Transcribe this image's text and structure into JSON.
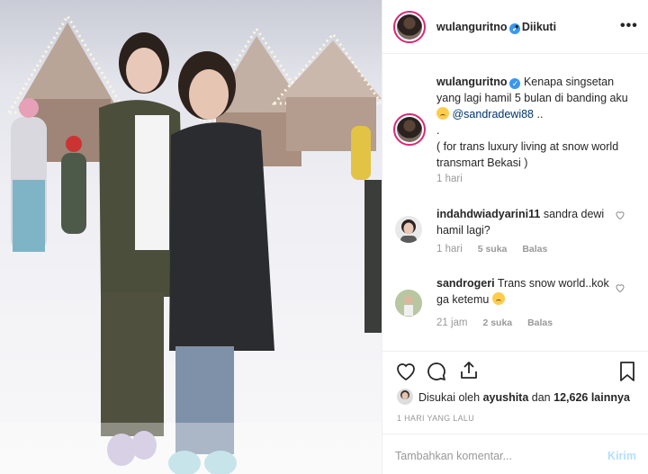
{
  "post": {
    "username": "wulanguritno",
    "follow_status": "Diikuti",
    "more_label": "•••",
    "caption_text": "Kenapa singsetan yang lagi hamil 5 bulan di banding aku",
    "caption_mention": "@sandradewi88",
    "caption_after": "..",
    "caption_dot": ".",
    "caption_extra": "( for trans luxury living at snow world transmart Bekasi )",
    "caption_time": "1 hari"
  },
  "comments": [
    {
      "username": "indahdwiadyarini11",
      "text": "sandra dewi hamil lagi?",
      "time": "1 hari",
      "likes": "5 suka",
      "reply": "Balas"
    },
    {
      "username": "sandrogeri",
      "text": "Trans snow world..kok ga ketemu",
      "time": "21 jam",
      "likes": "2 suka",
      "reply": "Balas"
    }
  ],
  "likes": {
    "prefix": "Disukai oleh",
    "user": "ayushita",
    "middle": "dan",
    "count": "12,626 lainnya"
  },
  "date": "1 HARI YANG LALU",
  "add_comment": {
    "placeholder": "Tambahkan komentar...",
    "send_label": "Kirim"
  },
  "colors": {
    "verified": "#3897f0",
    "story_ring": "#d62976",
    "send_disabled": "#b2dffc"
  }
}
